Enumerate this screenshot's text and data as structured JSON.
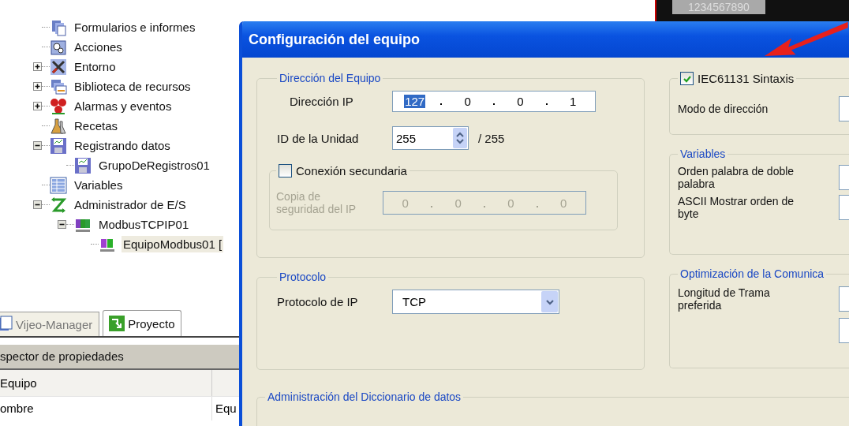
{
  "project_tree": [
    {
      "label": "Formularios e informes",
      "kind": "forms",
      "selected": false
    },
    {
      "label": "Acciones",
      "kind": "gears",
      "selected": false
    },
    {
      "label": "Entorno",
      "kind": "tools",
      "expanded": false,
      "selected": false
    },
    {
      "label": "Biblioteca de recursos",
      "kind": "library",
      "expanded": false,
      "selected": false
    },
    {
      "label": "Alarmas y eventos",
      "kind": "alarm",
      "expanded": false,
      "selected": false
    },
    {
      "label": "Recetas",
      "kind": "flask",
      "selected": false
    },
    {
      "label": "Registrando datos",
      "kind": "disk",
      "expanded": true,
      "selected": false,
      "children": [
        {
          "label": "GrupoDeRegistros01",
          "kind": "disk",
          "selected": false
        }
      ]
    },
    {
      "label": "Variables",
      "kind": "table",
      "selected": false
    },
    {
      "label": "Administrador de E/S",
      "kind": "arrows",
      "expanded": true,
      "selected": false,
      "children": [
        {
          "label": "ModbusTCPIP01",
          "kind": "blocks",
          "expanded": true,
          "selected": false,
          "children": [
            {
              "label": "EquipoModbus01 [",
              "kind": "pair",
              "selected": true
            }
          ]
        }
      ]
    }
  ],
  "tabs": [
    {
      "label": "Vijeo-Manager",
      "kind": "manager",
      "selected": false
    },
    {
      "label": "Proyecto",
      "kind": "project",
      "selected": true
    }
  ],
  "inspector": {
    "title": "spector de propiedades",
    "section": "Equipo",
    "rows": [
      {
        "name": "ombre",
        "value": "Equ"
      }
    ]
  },
  "background_ruler": {
    "text": "1234567890"
  },
  "dialog": {
    "title": "Configuración del equipo",
    "address_group": {
      "legend": "Dirección del Equipo",
      "ip_label": "Dirección IP",
      "ip_octets": [
        {
          "value": "127",
          "selected": true
        },
        {
          "value": "0",
          "selected": false
        },
        {
          "value": "0",
          "selected": false
        },
        {
          "value": "1",
          "selected": false
        }
      ],
      "unit_label": "ID de la Unidad",
      "unit_value": "255",
      "unit_max": "/ 255",
      "secondary": {
        "label": "Conexión secundaria",
        "checked": false,
        "backup_label": "Copia de seguridad del IP",
        "disabled": true,
        "backup_octets": [
          "0",
          "0",
          "0",
          "0"
        ]
      }
    },
    "syntax_group": {
      "label": "IEC61131 Sintaxis",
      "checked": true,
      "mode_label": "Modo de dirección"
    },
    "variables_group": {
      "legend": "Variables",
      "rows": [
        "Orden palabra de doble palabra",
        "ASCII Mostrar orden de byte"
      ]
    },
    "protocol_group": {
      "legend": "Protocolo",
      "label": "Protocolo de IP",
      "value": "TCP"
    },
    "optimization_group": {
      "legend": "Optimización de la Comunica",
      "label": "Longitud de Trama preferida"
    },
    "dictionary_group": {
      "legend": "Administración del Diccionario de datos"
    }
  }
}
